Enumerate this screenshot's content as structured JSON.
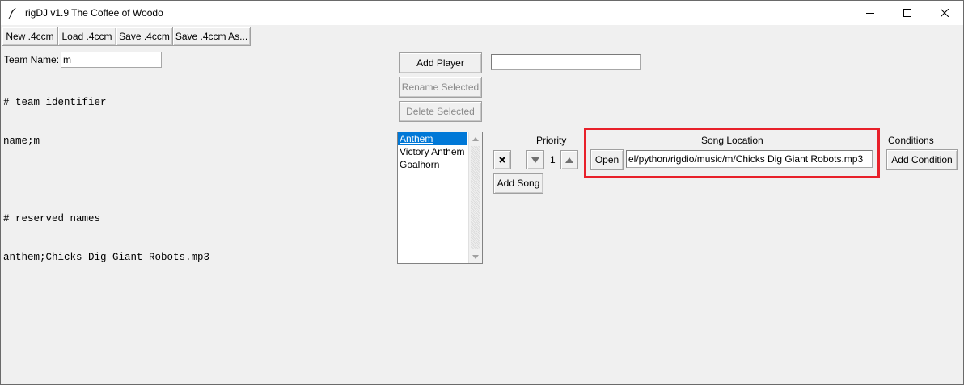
{
  "window": {
    "title": "rigDJ v1.9 The Coffee of Woodo",
    "controls": {
      "minimize": "minimize-icon",
      "maximize": "maximize-icon",
      "close": "close-icon"
    }
  },
  "toolbar": {
    "new_label": "New .4ccm",
    "load_label": "Load .4ccm",
    "save_label": "Save .4ccm",
    "save_as_label": "Save .4ccm As..."
  },
  "team": {
    "name_label": "Team Name:",
    "name_value": "m"
  },
  "editor": {
    "lines": [
      "# team identifier",
      "name;m",
      "",
      "# reserved names",
      "anthem;Chicks Dig Giant Robots.mp3"
    ]
  },
  "players": {
    "add_player_label": "Add Player",
    "rename_selected_label": "Rename Selected",
    "delete_selected_label": "Delete Selected",
    "new_player_value": "",
    "list": [
      "Anthem",
      "Victory Anthem",
      "Goalhorn"
    ],
    "selected_index": 0
  },
  "songs": {
    "priority_header": "Priority",
    "location_header": "Song Location",
    "conditions_header": "Conditions",
    "priority_value": "1",
    "open_label": "Open",
    "location_value": "el/python/rigdio/music/m/Chicks Dig Giant Robots.mp3",
    "add_condition_label": "Add Condition",
    "add_song_label": "Add Song",
    "remove_icon": "x-icon",
    "down_icon": "arrow-down-icon",
    "up_icon": "arrow-up-icon"
  },
  "colors": {
    "selection": "#0078d7",
    "highlight": "#e8202a",
    "background": "#f0f0f0"
  }
}
